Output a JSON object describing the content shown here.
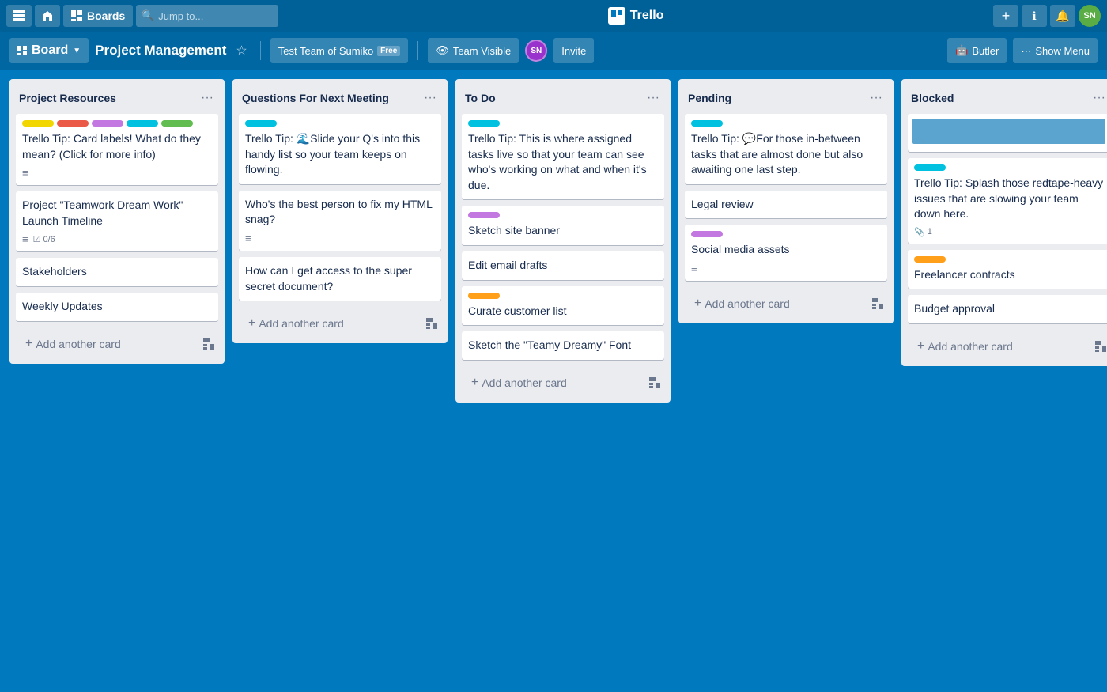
{
  "topNav": {
    "boardsLabel": "Boards",
    "searchPlaceholder": "Jump to...",
    "appName": "Trello",
    "plusTitle": "+",
    "infoTitle": "ℹ",
    "bellTitle": "🔔",
    "avatarInitials": "SN"
  },
  "boardHeader": {
    "boardLabel": "Board",
    "title": "Project Management",
    "teamLabel": "Test Team of Sumiko",
    "freeLabel": "Free",
    "visibleIcon": "👁",
    "visibleLabel": "Team Visible",
    "memberInitials": "SN",
    "inviteLabel": "Invite",
    "butlerIcon": "🤖",
    "butlerLabel": "Butler",
    "showMenuIcon": "···",
    "showMenuLabel": "Show Menu"
  },
  "columns": [
    {
      "id": "project-resources",
      "title": "Project Resources",
      "cards": [
        {
          "id": "card-1",
          "labels": [
            "yellow",
            "red",
            "purple",
            "teal",
            "green"
          ],
          "text": "Trello Tip: Card labels! What do they mean? (Click for more info)",
          "hasDesc": true
        },
        {
          "id": "card-2",
          "labels": [],
          "text": "Project \"Teamwork Dream Work\" Launch Timeline",
          "hasDesc": true,
          "checklist": "0/6"
        },
        {
          "id": "card-3",
          "labels": [],
          "text": "Stakeholders"
        },
        {
          "id": "card-4",
          "labels": [],
          "text": "Weekly Updates"
        }
      ],
      "addCardLabel": "Add another card"
    },
    {
      "id": "questions-for-next-meeting",
      "title": "Questions For Next Meeting",
      "cards": [
        {
          "id": "card-5",
          "labels": [
            "teal"
          ],
          "text": "Trello Tip: 🌊Slide your Q's into this handy list so your team keeps on flowing.",
          "hasDesc": false
        },
        {
          "id": "card-6",
          "labels": [],
          "text": "Who's the best person to fix my HTML snag?",
          "hasDesc": true
        },
        {
          "id": "card-7",
          "labels": [],
          "text": "How can I get access to the super secret document?"
        }
      ],
      "addCardLabel": "Add another card"
    },
    {
      "id": "to-do",
      "title": "To Do",
      "cards": [
        {
          "id": "card-8",
          "labels": [
            "teal"
          ],
          "text": "Trello Tip: This is where assigned tasks live so that your team can see who's working on what and when it's due."
        },
        {
          "id": "card-9",
          "labels": [
            "purple"
          ],
          "text": "Sketch site banner"
        },
        {
          "id": "card-10",
          "labels": [],
          "text": "Edit email drafts"
        },
        {
          "id": "card-11",
          "labels": [
            "orange"
          ],
          "text": "Curate customer list"
        },
        {
          "id": "card-12",
          "labels": [],
          "text": "Sketch the \"Teamy Dreamy\" Font"
        }
      ],
      "addCardLabel": "Add another card"
    },
    {
      "id": "pending",
      "title": "Pending",
      "cards": [
        {
          "id": "card-13",
          "labels": [
            "teal"
          ],
          "text": "Trello Tip: 💬For those in-between tasks that are almost done but also awaiting one last step."
        },
        {
          "id": "card-14",
          "labels": [],
          "text": "Legal review"
        },
        {
          "id": "card-15",
          "labels": [
            "purple"
          ],
          "text": "Social media assets",
          "hasDesc": true
        }
      ],
      "addCardLabel": "Add another card"
    },
    {
      "id": "blocked",
      "title": "Blocked",
      "cards": [
        {
          "id": "card-16",
          "labels": [
            "blue-header"
          ],
          "text": "",
          "isHeaderCard": true
        },
        {
          "id": "card-17",
          "labels": [
            "teal"
          ],
          "text": "Trello Tip: Splash those redtape-heavy issues that are slowing your team down here.",
          "attachments": 1
        },
        {
          "id": "card-18",
          "labels": [
            "orange"
          ],
          "text": "Freelancer contracts"
        },
        {
          "id": "card-19",
          "labels": [],
          "text": "Budget approval"
        }
      ],
      "addCardLabel": "Add another card"
    }
  ]
}
